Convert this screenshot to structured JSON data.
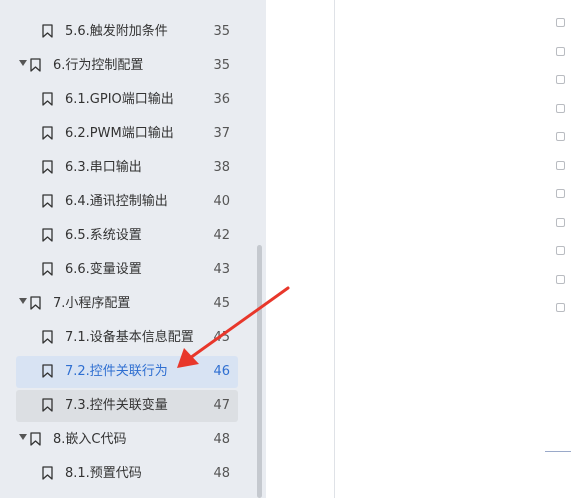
{
  "toc": {
    "items": [
      {
        "label": "5.6.触发附加条件",
        "page": "35",
        "level": 2,
        "state": "normal"
      },
      {
        "label": "6.行为控制配置",
        "page": "35",
        "level": 1,
        "state": "normal"
      },
      {
        "label": "6.1.GPIO端口输出",
        "page": "36",
        "level": 2,
        "state": "normal"
      },
      {
        "label": "6.2.PWM端口输出",
        "page": "37",
        "level": 2,
        "state": "normal"
      },
      {
        "label": "6.3.串口输出",
        "page": "38",
        "level": 2,
        "state": "normal"
      },
      {
        "label": "6.4.通讯控制输出",
        "page": "40",
        "level": 2,
        "state": "normal"
      },
      {
        "label": "6.5.系统设置",
        "page": "42",
        "level": 2,
        "state": "normal"
      },
      {
        "label": "6.6.变量设置",
        "page": "43",
        "level": 2,
        "state": "normal"
      },
      {
        "label": "7.小程序配置",
        "page": "45",
        "level": 1,
        "state": "normal"
      },
      {
        "label": "7.1.设备基本信息配置",
        "page": "45",
        "level": 2,
        "state": "normal"
      },
      {
        "label": "7.2.控件关联行为",
        "page": "46",
        "level": 2,
        "state": "selected"
      },
      {
        "label": "7.3.控件关联变量",
        "page": "47",
        "level": 2,
        "state": "hover"
      },
      {
        "label": "8.嵌入C代码",
        "page": "48",
        "level": 1,
        "state": "normal"
      },
      {
        "label": "8.1.预置代码",
        "page": "48",
        "level": 2,
        "state": "normal"
      }
    ]
  },
  "right_rail": {
    "icons": [
      "home-icon",
      "layers-icon",
      "hash-icon",
      "page-icon",
      "image-icon",
      "compass-icon",
      "grid-icon",
      "smile-icon",
      "file-icon",
      "archive-icon",
      "user-icon"
    ]
  },
  "colors": {
    "sidebar_bg": "#e9ecf1",
    "selected_bg": "#d8e3f3",
    "selected_text": "#2f6fd1",
    "hover_bg": "#dcdfe3",
    "annotation_arrow": "#e8372b"
  }
}
